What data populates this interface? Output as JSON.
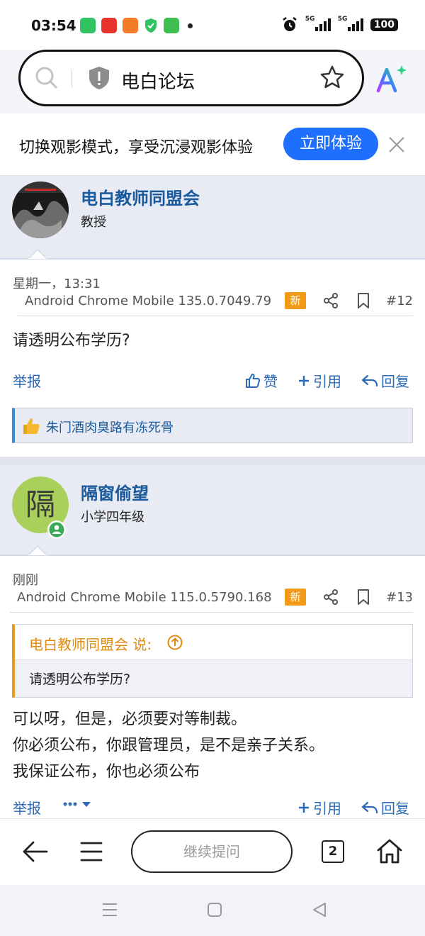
{
  "status_bar": {
    "time": "03:54",
    "battery": "100",
    "network": [
      "5G",
      "5G"
    ]
  },
  "browser": {
    "url_text": "电白论坛"
  },
  "promo": {
    "text": "切换观影模式，享受沉浸观影体验",
    "button_label": "立即体验"
  },
  "posts": [
    {
      "username": "电白教师同盟会",
      "rank": "教授",
      "time": "星期一，13:31",
      "user_agent": "Android Chrome Mobile 135.0.7049.79",
      "new_badge": "新",
      "number": "#12",
      "body": [
        "请透明公布学历?"
      ],
      "actions": {
        "report": "举报",
        "like": "赞",
        "quote": "引用",
        "reply": "回复"
      },
      "likes": "朱门酒肉臭路有冻死骨"
    },
    {
      "username": "隔窗偷望",
      "rank": "小学四年级",
      "avatar_letter": "隔",
      "time": "刚刚",
      "user_agent": "Android Chrome Mobile 115.0.5790.168",
      "new_badge": "新",
      "number": "#13",
      "quote": {
        "author": "电白教师同盟会 说:",
        "text": "请透明公布学历?"
      },
      "body": [
        "可以呀，但是，必须要对等制裁。",
        "你必须公布，你跟管理员，是不是亲子关系。",
        "我保证公布，你也必须公布"
      ],
      "actions": {
        "report": "举报",
        "quote": "引用",
        "reply": "回复"
      }
    }
  ],
  "bottom_nav": {
    "ask_label": "继续提问",
    "tab_count": "2"
  },
  "colors": {
    "accent": "#1f6fff",
    "link": "#2a6ab8",
    "username": "#1a5a9c",
    "badge": "#f29a18"
  }
}
